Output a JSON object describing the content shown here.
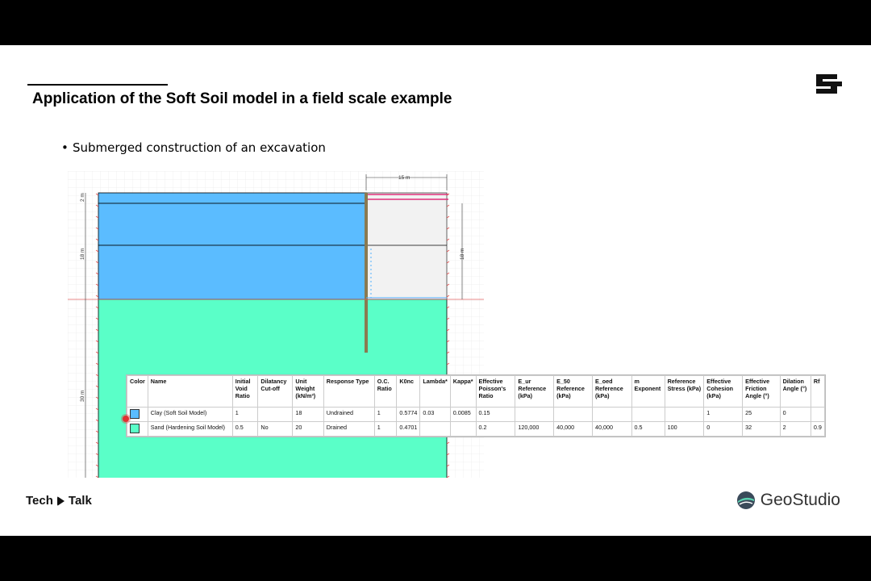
{
  "slide": {
    "title": "Application of the Soft Soil model in a field scale example",
    "bullet": "Submerged construction of an excavation"
  },
  "model": {
    "dim_top": "15 m",
    "dim_left_1": "2 m",
    "dim_left_2": "18 m",
    "dim_left_3": "30 m",
    "dim_right": "18 m",
    "colors": {
      "clay": "#5bbcff",
      "sand": "#5affc8",
      "wall": "#8a7a50",
      "load": "#e0307a"
    }
  },
  "table": {
    "headers": [
      "Color",
      "Name",
      "Initial Void Ratio",
      "Dilatancy Cut-off",
      "Unit Weight (kN/m³)",
      "Response Type",
      "O.C. Ratio",
      "K0nc",
      "Lambda*",
      "Kappa*",
      "Effective Poisson's Ratio",
      "E_ur Reference (kPa)",
      "E_50 Reference (kPa)",
      "E_oed Reference (kPa)",
      "m Exponent",
      "Reference Stress (kPa)",
      "Effective Cohesion (kPa)",
      "Effective Friction Angle (°)",
      "Dilation Angle (°)",
      "Rf"
    ],
    "rows": [
      {
        "color": "#5bbcff",
        "cells": [
          "Clay (Soft Soil Model)",
          "1",
          "",
          "18",
          "Undrained",
          "1",
          "0.5774",
          "0.03",
          "0.0085",
          "0.15",
          "",
          "",
          "",
          "",
          "",
          "1",
          "25",
          "0",
          ""
        ]
      },
      {
        "color": "#5affc8",
        "cells": [
          "Sand (Hardening Soil Model)",
          "0.5",
          "No",
          "20",
          "Drained",
          "1",
          "0.4701",
          "",
          "",
          "0.2",
          "120,000",
          "40,000",
          "40,000",
          "0.5",
          "100",
          "0",
          "32",
          "2",
          "0.9"
        ]
      }
    ]
  },
  "footer": {
    "tech": "Tech",
    "talk": "Talk",
    "brand": "GeoStudio"
  }
}
